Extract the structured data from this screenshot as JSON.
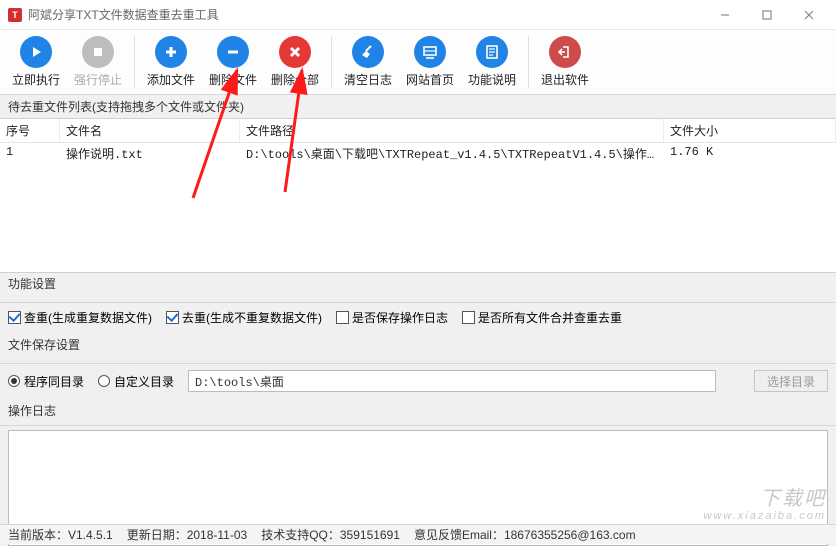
{
  "window": {
    "title": "阿斌分享TXT文件数据查重去重工具"
  },
  "toolbar": {
    "run": "立即执行",
    "stop": "强行停止",
    "add": "添加文件",
    "remove": "删除文件",
    "removeAll": "删除全部",
    "clearLog": "清空日志",
    "homepage": "网站首页",
    "help": "功能说明",
    "exit": "退出软件"
  },
  "fileList": {
    "caption": "待去重文件列表(支持拖拽多个文件或文件夹)",
    "headers": {
      "idx": "序号",
      "name": "文件名",
      "path": "文件路径",
      "size": "文件大小"
    },
    "rows": [
      {
        "idx": "1",
        "name": "操作说明.txt",
        "path": "D:\\tools\\桌面\\下载吧\\TXTRepeat_v1.4.5\\TXTRepeatV1.4.5\\操作说...",
        "size": "1.76 K"
      }
    ]
  },
  "funcSettings": {
    "title": "功能设置",
    "cb1": "查重(生成重复数据文件)",
    "cb2": "去重(生成不重复数据文件)",
    "cb3": "是否保存操作日志",
    "cb4": "是否所有文件合并查重去重"
  },
  "saveSettings": {
    "title": "文件保存设置",
    "r1": "程序同目录",
    "r2": "自定义目录",
    "path": "D:\\tools\\桌面",
    "chooseBtn": "选择目录"
  },
  "log": {
    "title": "操作日志"
  },
  "status": {
    "version": "当前版本：V1.4.5.1",
    "date": "更新日期：2018-11-03",
    "qq": "技术支持QQ：359151691",
    "email": "意见反馈Email：18676355256@163.com"
  },
  "watermark": {
    "line1": "下载吧",
    "line2": "www.xiazaiba.com"
  }
}
